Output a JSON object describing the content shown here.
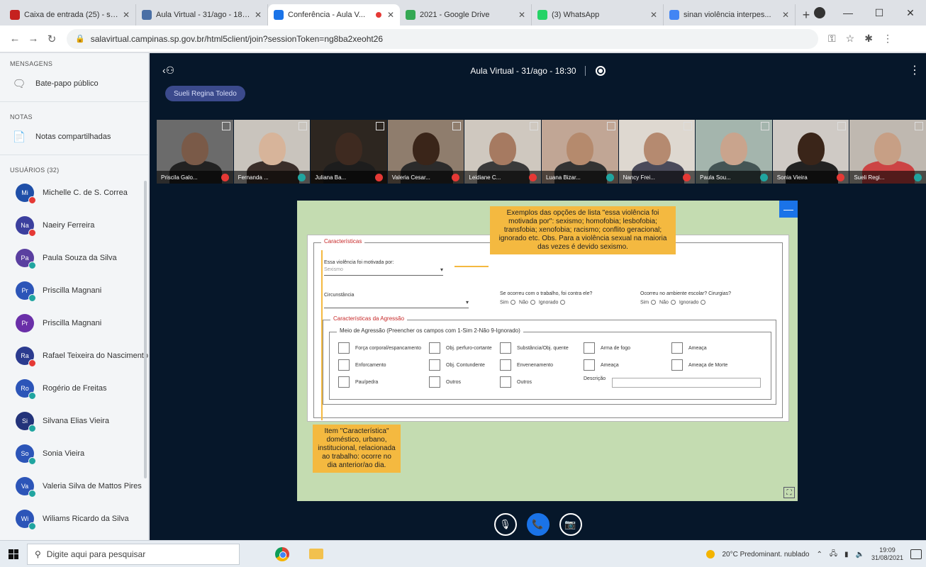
{
  "browser": {
    "tabs": [
      {
        "title": "Caixa de entrada (25) - san...",
        "fav": "#c5221f",
        "active": false
      },
      {
        "title": "Aula Virtual - 31/ago - 18:3...",
        "fav": "#4a6fa5",
        "active": false
      },
      {
        "title": "Conferência - Aula V...",
        "fav": "#1a73e8",
        "active": true
      },
      {
        "title": "2021 - Google Drive",
        "fav": "#34a853",
        "active": false
      },
      {
        "title": "(3) WhatsApp",
        "fav": "#25d366",
        "active": false
      },
      {
        "title": "sinan violência interpes...",
        "fav": "#4285f4",
        "active": false
      }
    ],
    "new_tab": "+",
    "url": "salavirtual.campinas.sp.gov.br/html5client/join?sessionToken=ng8ba2xeoht26",
    "lock_icon": "🔒"
  },
  "sidebar": {
    "messages_heading": "MENSAGENS",
    "public_chat": "Bate-papo público",
    "notes_heading": "NOTAS",
    "shared_notes": "Notas compartilhadas",
    "users_heading": "USUÁRIOS (32)",
    "users": [
      {
        "initials": "Mi",
        "name": "Michelle C. de S. Correa",
        "color": "#1f4fa8",
        "badge": "#e53935"
      },
      {
        "initials": "Na",
        "name": "Naeiry Ferreira",
        "color": "#3b3f9e",
        "badge": "#e53935"
      },
      {
        "initials": "Pa",
        "name": "Paula Souza da Silva",
        "color": "#5a3fa0",
        "badge": "#20a5a0"
      },
      {
        "initials": "Pr",
        "name": "Priscilla Magnani",
        "color": "#2c55b8",
        "badge": "#20a5a0"
      },
      {
        "initials": "Pr",
        "name": "Priscilla Magnani",
        "color": "#6a2fa8",
        "badge": ""
      },
      {
        "initials": "Ra",
        "name": "Rafael Teixeira do Nascimento",
        "color": "#2b3b8f",
        "badge": "#e53935"
      },
      {
        "initials": "Ro",
        "name": "Rogério de Freitas",
        "color": "#2c55b8",
        "badge": "#20a5a0"
      },
      {
        "initials": "Si",
        "name": "Silvana Elias Vieira",
        "color": "#23337a",
        "badge": "#20a5a0"
      },
      {
        "initials": "So",
        "name": "Sonia Vieira",
        "color": "#2c55b8",
        "badge": "#20a5a0"
      },
      {
        "initials": "Va",
        "name": "Valeria Silva de Mattos Pires",
        "color": "#2c55b8",
        "badge": "#20a5a0"
      },
      {
        "initials": "Wi",
        "name": "Wiliams Ricardo da Silva",
        "color": "#2c55b8",
        "badge": "#20a5a0"
      }
    ]
  },
  "meeting": {
    "title": "Aula Virtual - 31/ago - 18:30",
    "talking": "Sueli Regina Toledo",
    "participants": [
      {
        "name": "Priscila Galo...",
        "skin": "#7a5a48",
        "bg": "#6b6b6b",
        "shirt": "#222",
        "mic": "#e53935"
      },
      {
        "name": "Fernanda ...",
        "skin": "#d7b49a",
        "bg": "#c9c4bd",
        "shirt": "#3a2e2a",
        "mic": "#20a5a0"
      },
      {
        "name": "Juliana Ba...",
        "skin": "#3e2a20",
        "bg": "#2d2620",
        "shirt": "#1d1d1d",
        "mic": "#e53935"
      },
      {
        "name": "Valeria Cesar...",
        "skin": "#3a2519",
        "bg": "#8f7d6d",
        "shirt": "#2b2b2b",
        "mic": "#e53935"
      },
      {
        "name": "Leidiane C...",
        "skin": "#a67a61",
        "bg": "#cfc8bf",
        "shirt": "#3a3a3a",
        "mic": "#e53935"
      },
      {
        "name": "Luana Bizar...",
        "skin": "#b58a6d",
        "bg": "#c1a695",
        "shirt": "#333",
        "mic": "#20a5a0"
      },
      {
        "name": "Nancy Frei...",
        "skin": "#b58a70",
        "bg": "#ded8d0",
        "shirt": "#4a4a5a",
        "mic": "#e53935"
      },
      {
        "name": "Paula Sou...",
        "skin": "#c9a48d",
        "bg": "#a4b5ad",
        "shirt": "#455",
        "mic": "#20a5a0"
      },
      {
        "name": "Sonia Vieira",
        "skin": "#3a2519",
        "bg": "#cfcac5",
        "shirt": "#222",
        "mic": "#e53935"
      },
      {
        "name": "Sueli Regi...",
        "skin": "#c79f85",
        "bg": "#bfb8b0",
        "shirt": "#c44",
        "mic": "#20a5a0"
      }
    ]
  },
  "slide": {
    "legend_main": "Características",
    "field1_label": "Essa violência foi motivada por:",
    "field1_value": "Sexismo",
    "field2_label": "Circunstância",
    "q1_label": "Se ocorreu com o trabalho, foi contra ele?",
    "q2_label": "Ocorreu no ambiente escolar? Cirurgias?",
    "opt_sim": "Sim",
    "opt_nao": "Não",
    "opt_ign": "Ignorado",
    "legend_sub": "Características da Agressão",
    "legend_inner": "Meio de Agressão (Preencher os campos com 1-Sim 2-Não 9-Ignorado)",
    "checkboxes": [
      "Força corporal/espancamento",
      "Obj. perfuro-cortante",
      "Substância/Obj. quente",
      "Arma de fogo",
      "Ameaça",
      "Enforcamento",
      "Obj. Contundente",
      "Envenenamento",
      "Ameaça",
      "Ameaça de Morte",
      "Pau/pedra",
      "Outros",
      "Outros",
      "Descrição"
    ],
    "note_top": "Exemplos das opções de lista \"essa violência foi motivada por\": sexismo; homofobia; lesbofobia; transfobia; xenofobia; racismo; conflito geracional; ignorado etc. Obs. Para a violência sexual na maioria das vezes é devido sexismo.",
    "note_bottom": "Item \"Característica\" doméstico, urbano, institucional, relacionada ao trabalho: ocorre no dia anterior/ao dia."
  },
  "controls": {
    "mic_icon": "🎙",
    "phone_icon": "📞",
    "cam_icon": "📷"
  },
  "taskbar": {
    "search_placeholder": "Digite aqui para pesquisar",
    "weather": "20°C Predominant. nublado",
    "time": "19:09",
    "date": "31/08/2021"
  }
}
